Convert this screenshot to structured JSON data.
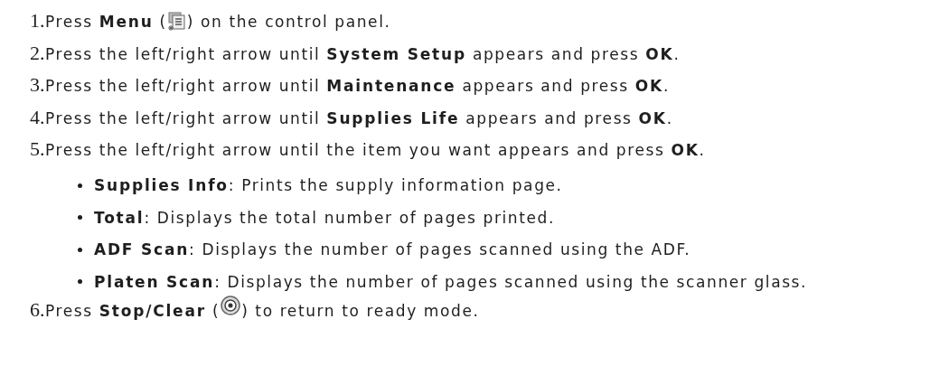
{
  "steps": [
    {
      "number": "1.",
      "segments": [
        {
          "kind": "text",
          "text": "Press **Menu** ("
        },
        {
          "kind": "menu_icon"
        },
        {
          "kind": "text",
          "text": ") on the control panel."
        }
      ]
    },
    {
      "number": "2.",
      "segments": [
        {
          "kind": "text",
          "text": "Press the left/right arrow until **System Setup** appears and press **OK**."
        }
      ]
    },
    {
      "number": "3.",
      "segments": [
        {
          "kind": "text",
          "text": "Press the left/right arrow until **Maintenance** appears and press **OK**."
        }
      ]
    },
    {
      "number": "4.",
      "segments": [
        {
          "kind": "text",
          "text": "Press the left/right arrow until **Supplies Life** appears and press **OK**."
        }
      ]
    },
    {
      "number": "5.",
      "segments": [
        {
          "kind": "text",
          "text": "Press the left/right arrow until the item you want appears and press **OK**."
        }
      ],
      "bullets": [
        "**Supplies Info**: Prints the supply information page.",
        "**Total**: Displays the total number of pages printed.",
        "**ADF Scan**: Displays the number of pages scanned using the ADF.",
        "**Platen Scan**: Displays the number of pages scanned using the scanner glass."
      ]
    },
    {
      "number": "6.",
      "segments": [
        {
          "kind": "text",
          "text": "Press **Stop/Clear** ("
        },
        {
          "kind": "stop_icon"
        },
        {
          "kind": "text",
          "text": ") to return to ready mode."
        }
      ]
    }
  ]
}
